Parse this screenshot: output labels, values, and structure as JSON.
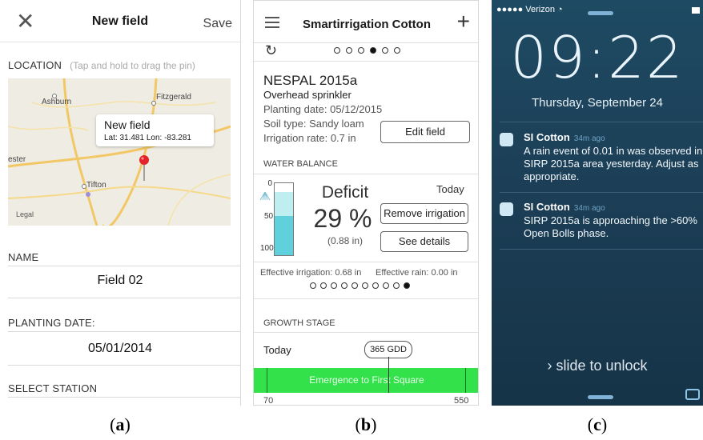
{
  "panel_a": {
    "nav": {
      "close_icon": "close-icon",
      "title": "New field",
      "save_label": "Save"
    },
    "location": {
      "label": "LOCATION",
      "hint": "(Tap and hold to drag the pin)"
    },
    "map": {
      "towns": [
        "Ashburn",
        "Fitzgerald",
        "ester",
        "Tifton"
      ],
      "tooltip_title": "New field",
      "tooltip_coords": "Lat: 31.481 Lon: -83.281",
      "legal": "Legal"
    },
    "name": {
      "label": "NAME",
      "value": "Field 02"
    },
    "planting_date": {
      "label": "PLANTING DATE:",
      "value": "05/01/2014"
    },
    "station": {
      "label": "SELECT STATION"
    },
    "caption": "a"
  },
  "panel_b": {
    "nav": {
      "title": "Smartirrigation Cotton",
      "menu_icon": "hamburger-icon",
      "add_icon": "plus-icon"
    },
    "page_dots": {
      "count": 6,
      "active": 3
    },
    "field": {
      "name": "NESPAL 2015a",
      "irrigation_type": "Overhead sprinkler",
      "planting_date": "Planting date: 05/12/2015",
      "soil_type": "Soil type: Sandy loam",
      "irrigation_rate": "Irrigation rate: 0.7 in",
      "edit_label": "Edit field"
    },
    "water_balance": {
      "label": "WATER BALANCE",
      "status": "Deficit",
      "percent": "29 %",
      "inches": "(0.88 in)",
      "day": "Today",
      "remove_label": "Remove irrigation",
      "details_label": "See details",
      "scale": [
        "0",
        "50",
        "100"
      ],
      "deficit_fraction": 0.29,
      "effective_irrigation": "Effective irrigation: 0.68 in",
      "effective_rain": "Effective rain: 0.00 in",
      "day_dots": {
        "count": 10,
        "active": 9
      }
    },
    "growth": {
      "label": "GROWTH STAGE",
      "today": "Today",
      "gdd": "365 GDD",
      "stage": "Emergence to First Square",
      "range_min": "70",
      "range_max": "550",
      "bar_color": "#33e24a"
    },
    "caption": "b"
  },
  "panel_c": {
    "status": {
      "carrier": "Verizon"
    },
    "time": "09:22",
    "date": "Thursday, September 24",
    "notifications": [
      {
        "app": "SI Cotton",
        "ago": "34m ago",
        "message": "A rain event of 0.01 in was observed in SIRP 2015a area yesterday. Adjust as appropriate."
      },
      {
        "app": "SI Cotton",
        "ago": "34m ago",
        "message": "SIRP 2015a is approaching the >60% Open Bolls phase."
      }
    ],
    "slide_text": "slide to unlock",
    "caption": "c"
  }
}
